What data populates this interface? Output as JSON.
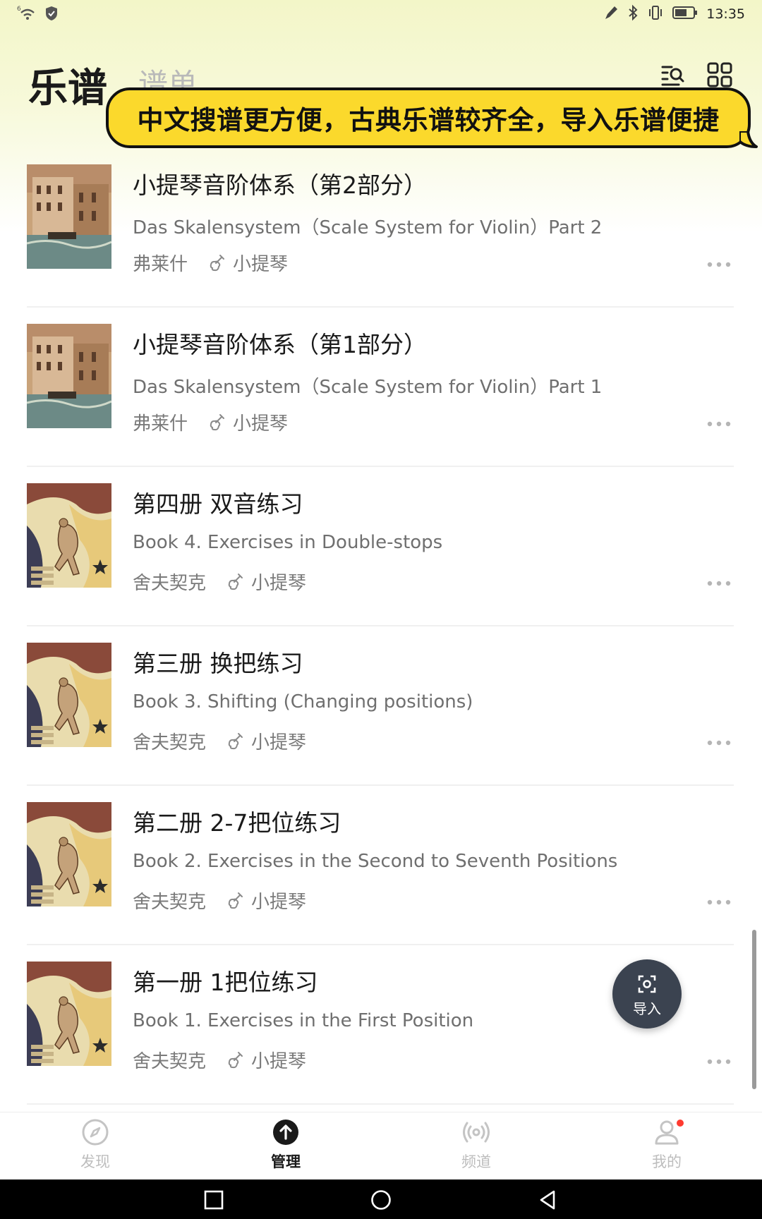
{
  "status_bar": {
    "time": "13:35",
    "signal_label": "6"
  },
  "header": {
    "tab_active": "乐谱",
    "tab_inactive": "谱单",
    "search_icon": "search-list-icon",
    "grid_icon": "grid-view-icon"
  },
  "banner": {
    "text": "中文搜谱更方便，古典乐谱较齐全，导入乐谱便捷"
  },
  "scores": [
    {
      "title": "小提琴音阶体系（第2部分）",
      "subtitle": "Das Skalensystem（Scale System for Violin）Part 2",
      "composer": "弗莱什",
      "instrument": "小提琴",
      "cover": "venice-painting"
    },
    {
      "title": "小提琴音阶体系（第1部分）",
      "subtitle": "Das Skalensystem（Scale System for Violin）Part 1",
      "composer": "弗莱什",
      "instrument": "小提琴",
      "cover": "venice-painting"
    },
    {
      "title": "第四册 双音练习",
      "subtitle": "Book 4. Exercises in Double-stops",
      "composer": "舍夫契克",
      "instrument": "小提琴",
      "cover": "blake-engraving"
    },
    {
      "title": "第三册 换把练习",
      "subtitle": "Book 3. Shifting (Changing positions)",
      "composer": "舍夫契克",
      "instrument": "小提琴",
      "cover": "blake-engraving"
    },
    {
      "title": "第二册 2-7把位练习",
      "subtitle": "Book 2. Exercises in the Second to Seventh Positions",
      "composer": "舍夫契克",
      "instrument": "小提琴",
      "cover": "blake-engraving"
    },
    {
      "title": "第一册 1把位练习",
      "subtitle": "Book 1. Exercises in the First Position",
      "composer": "舍夫契克",
      "instrument": "小提琴",
      "cover": "blake-engraving"
    }
  ],
  "fab": {
    "label": "导入",
    "icon": "scan-icon"
  },
  "bottom_nav": [
    {
      "label": "发现",
      "icon": "compass-icon",
      "active": false
    },
    {
      "label": "管理",
      "icon": "upload-circle-icon",
      "active": true
    },
    {
      "label": "频道",
      "icon": "broadcast-icon",
      "active": false
    },
    {
      "label": "我的",
      "icon": "profile-icon",
      "active": false,
      "badge": true
    }
  ],
  "colors": {
    "banner_bg": "#fbd92c",
    "header_gradient": "#f3f6c8",
    "fab_bg": "#3b4350",
    "badge": "#ff3b30"
  }
}
